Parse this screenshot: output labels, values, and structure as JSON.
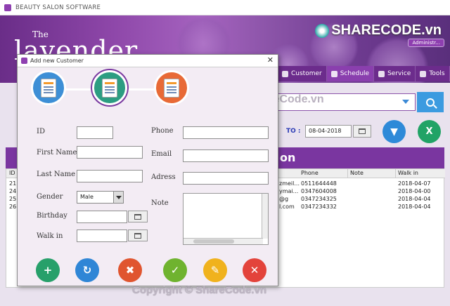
{
  "main": {
    "window_title": "BEAUTY SALON SOFTWARE",
    "logo_small": "The",
    "logo_big": "lavender",
    "watermark_logo": "SHARECODE.vn",
    "user_label": "Administr...",
    "menu": [
      "Customer",
      "Schedule",
      "Service",
      "Tools"
    ],
    "search_value": "",
    "to_label": "TO :",
    "to_date": "08-04-2018",
    "table_heading": "on",
    "table": {
      "columns": [
        "ID",
        "",
        "",
        "",
        "Phone",
        "Note",
        "Walk in"
      ],
      "rows": [
        {
          "id": "21",
          "email": "zmeil...",
          "phone": "0511644448",
          "note": "",
          "walkin": "2018-04-07"
        },
        {
          "id": "24",
          "email": "ymai...",
          "phone": "0347604008",
          "note": "",
          "walkin": "2018-04-00"
        },
        {
          "id": "25",
          "email": "@g",
          "phone": "0347234325",
          "note": "",
          "walkin": "2018-04-04"
        },
        {
          "id": "26",
          "email": "l.com",
          "phone": "0347234332",
          "note": "",
          "walkin": "2018-04-04"
        }
      ]
    },
    "mid_watermark": "ShareCode.vn",
    "footer_watermark": "Copyright © ShareCode.vn"
  },
  "dialog": {
    "title": "Add new Customer",
    "labels": {
      "id": "ID",
      "first_name": "First Name",
      "last_name": "Last Name",
      "gender": "Gender",
      "birthday": "Birthday",
      "walk_in": "Walk in",
      "phone": "Phone",
      "email": "Email",
      "adress": "Adress",
      "note": "Note"
    },
    "gender_value": "Male",
    "step_colors": [
      "#3d8fd6",
      "#2c9d82",
      "#e86a36"
    ]
  }
}
